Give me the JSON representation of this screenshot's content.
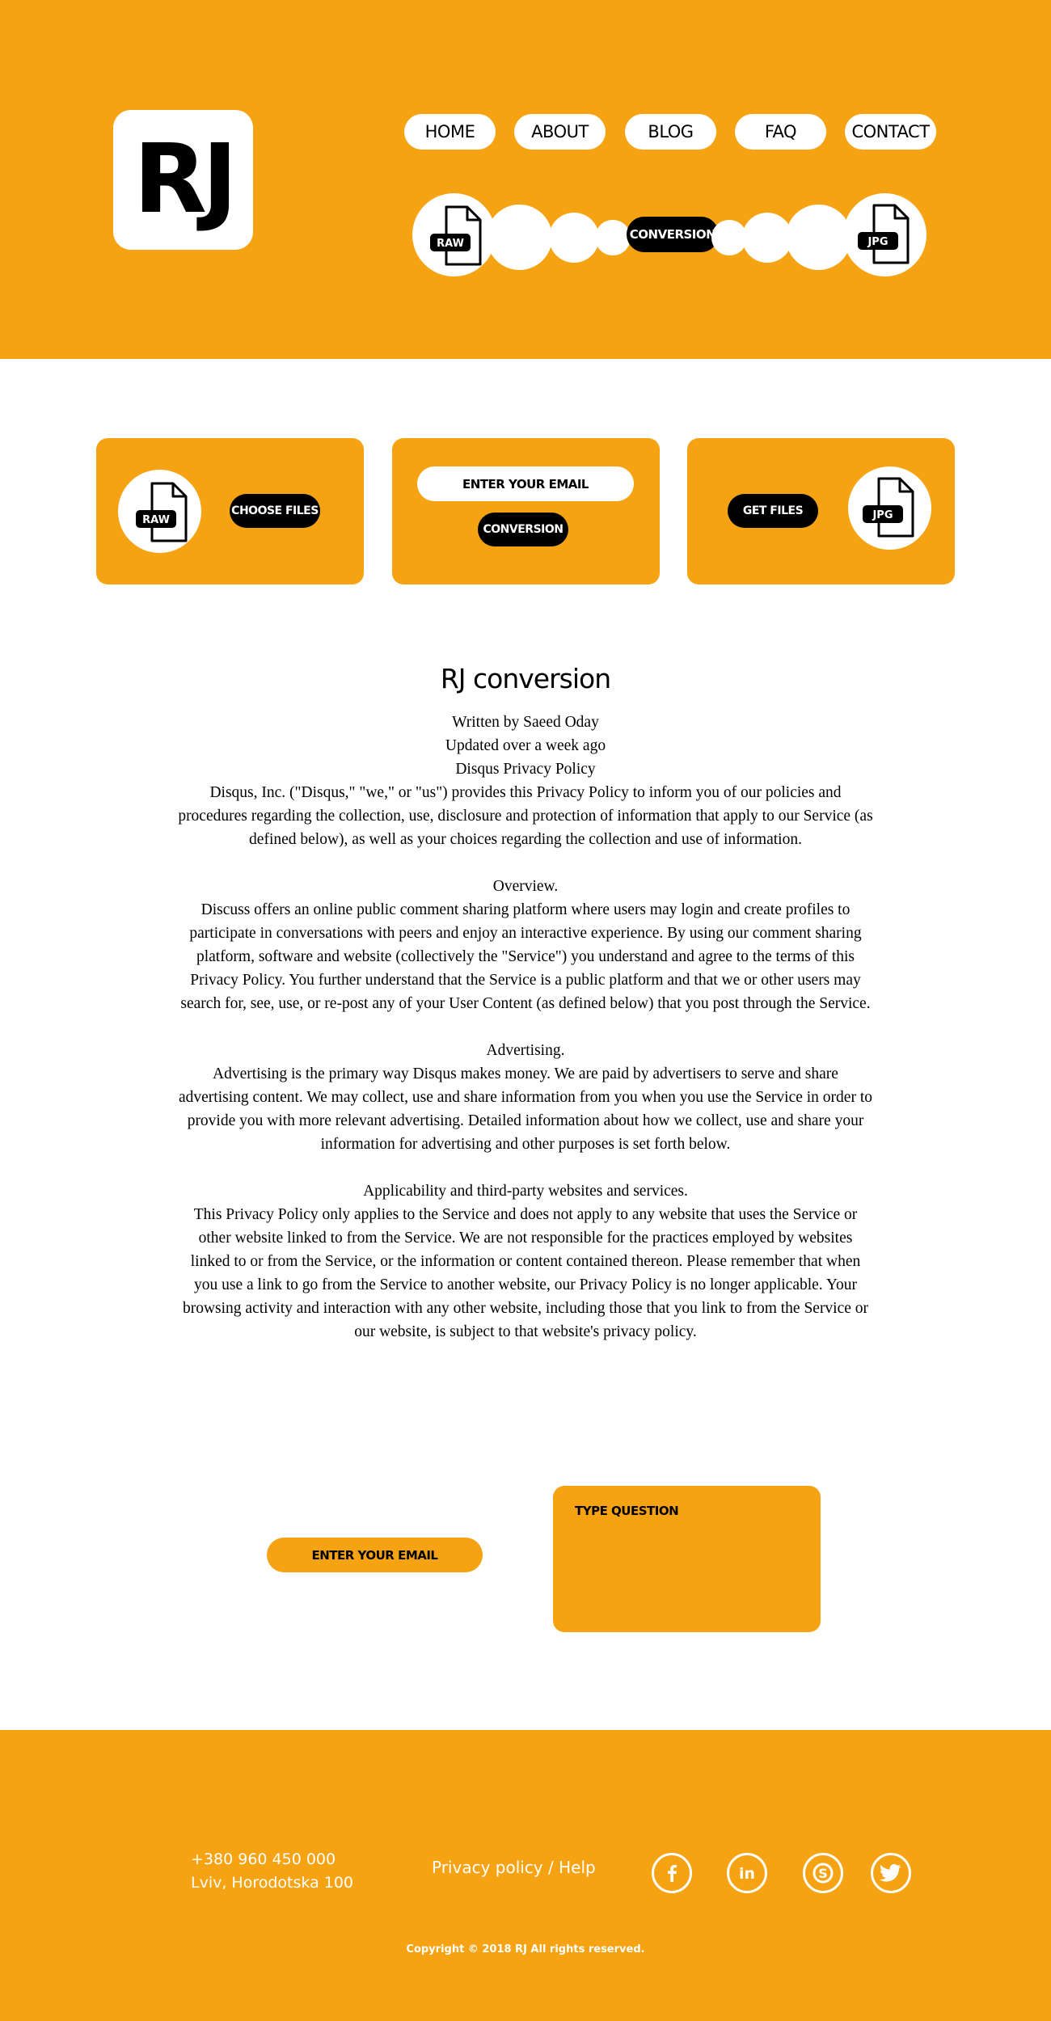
{
  "logo": {
    "text": "RJ"
  },
  "nav": {
    "items": [
      {
        "label": "HOME"
      },
      {
        "label": "ABOUT"
      },
      {
        "label": "BLOG"
      },
      {
        "label": "FAQ"
      },
      {
        "label": "CONTACT"
      }
    ]
  },
  "hero": {
    "from_format": "RAW",
    "to_format": "JPG",
    "conversion_label": "CONVERSION"
  },
  "cards": {
    "upload": {
      "format": "RAW",
      "button": "CHOOSE FILES"
    },
    "convert": {
      "email_placeholder": "ENTER YOUR EMAIL",
      "button": "CONVERSION"
    },
    "download": {
      "format": "JPG",
      "button": "GET FILES"
    }
  },
  "article": {
    "title": "RJ conversion",
    "paragraphs": [
      "Written by Saeed Oday",
      "Updated over a week ago",
      "Disqus Privacy Policy",
      "Disqus, Inc. (\"Disqus,\" \"we,\" or \"us\") provides this Privacy Policy to inform you of our policies and procedures regarding the collection, use, disclosure and protection of information that apply to our Service (as defined below), as well as your choices regarding the collection and use of information.",
      "Overview.",
      "Discuss offers an online public comment sharing platform where users may login and create profiles to participate in conversations with peers and enjoy an interactive experience. By using our comment sharing platform, software and website (collectively the \"Service\") you understand and agree to the terms of this Privacy Policy. You further understand that the Service is a public platform and that we or other users may search for, see, use, or re-post any of your User Content (as defined below) that you post through the Service.",
      "Advertising.",
      "Advertising is the primary way Disqus makes money. We are paid by advertisers to serve and share advertising content. We may collect, use and share information from you when you use the Service in order to provide you with more relevant advertising. Detailed information about how we collect, use and share your information for advertising and other purposes is set forth below.",
      "Applicability and third-party websites and services.",
      "This Privacy Policy only applies to the Service and does not apply to any website that uses the Service or other website linked to from the Service. We are not responsible for the practices employed by websites linked to or from the Service, or the information or content contained thereon. Please remember that when you use a link to go from the Service to another website, our Privacy Policy is no longer applicable. Your browsing activity and interaction with any other website, including those that you link to from the Service or our website, is subject to that website's privacy policy."
    ]
  },
  "question": {
    "email_placeholder": "ENTER YOUR EMAIL",
    "question_placeholder": "TYPE QUESTION"
  },
  "footer": {
    "phone": "+380 960 450 000",
    "address": "Lviv, Horodotska 100",
    "links": "Privacy policy / Help",
    "social": [
      "facebook-icon",
      "linkedin-icon",
      "skype-icon",
      "twitter-icon"
    ],
    "copyright": "Copyright © 2018 RJ All rights reserved."
  },
  "colors": {
    "accent": "#f5a313",
    "dark": "#000000",
    "light": "#ffffff"
  }
}
